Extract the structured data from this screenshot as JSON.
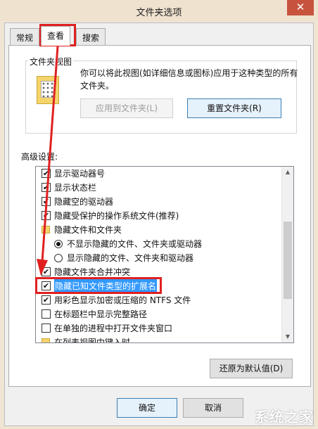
{
  "window": {
    "title": "文件夹选项",
    "close_symbol": "✕"
  },
  "tabs": [
    {
      "label": "常规"
    },
    {
      "label": "查看"
    },
    {
      "label": "搜索"
    }
  ],
  "folder_views": {
    "legend": "文件夹视图",
    "description": "你可以将此视图(如详细信息或图标)应用于这种类型的所有文件夹。",
    "apply_button": "应用到文件夹(L)",
    "reset_button": "重置文件夹(R)"
  },
  "advanced": {
    "label": "高级设置:",
    "items": [
      {
        "kind": "checkbox",
        "checked": true,
        "label": "显示驱动器号"
      },
      {
        "kind": "checkbox",
        "checked": true,
        "label": "显示状态栏"
      },
      {
        "kind": "checkbox",
        "checked": true,
        "label": "隐藏空的驱动器"
      },
      {
        "kind": "checkbox",
        "checked": true,
        "label": "隐藏受保护的操作系统文件(推荐)"
      },
      {
        "kind": "folder",
        "label": "隐藏文件和文件夹"
      },
      {
        "kind": "radio",
        "checked": true,
        "label": "不显示隐藏的文件、文件夹或驱动器"
      },
      {
        "kind": "radio",
        "checked": false,
        "label": "显示隐藏的文件、文件夹和驱动器"
      },
      {
        "kind": "checkbox",
        "checked": true,
        "label": "隐藏文件夹合并冲突"
      },
      {
        "kind": "checkbox",
        "checked": true,
        "label": "隐藏已知文件类型的扩展名",
        "selected": true
      },
      {
        "kind": "checkbox",
        "checked": true,
        "label": "用彩色显示加密或压缩的 NTFS 文件"
      },
      {
        "kind": "checkbox",
        "checked": false,
        "label": "在标题栏中显示完整路径"
      },
      {
        "kind": "checkbox",
        "checked": false,
        "label": "在单独的进程中打开文件夹窗口"
      },
      {
        "kind": "folder",
        "label": "在列表视图中键入时"
      }
    ]
  },
  "restore_button": "还原为默认值(D)",
  "footer": {
    "ok_button": "确定",
    "cancel_button": "取消",
    "watermark": "系统之家"
  },
  "colors": {
    "selection": "#3399ff",
    "annotation": "#e02020",
    "close": "#c7533f"
  }
}
